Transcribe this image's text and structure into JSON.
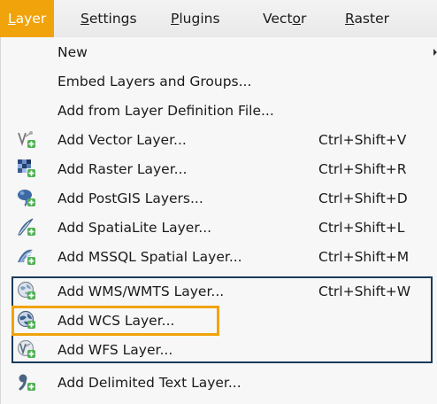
{
  "menubar": [
    {
      "pre": "",
      "u": "L",
      "post": "ayer",
      "active": true
    },
    {
      "pre": "",
      "u": "S",
      "post": "ettings",
      "active": false
    },
    {
      "pre": "",
      "u": "P",
      "post": "lugins",
      "active": false
    },
    {
      "pre": "Vect",
      "u": "o",
      "post": "r",
      "active": false
    },
    {
      "pre": "",
      "u": "R",
      "post": "aster",
      "active": false
    }
  ],
  "menu_items": [
    {
      "label": "New",
      "shortcut": "",
      "icon": "",
      "submenu": true
    },
    {
      "label": "Embed Layers and Groups...",
      "shortcut": "",
      "icon": ""
    },
    {
      "label": "Add from Layer Definition File...",
      "shortcut": "",
      "icon": ""
    },
    {
      "label": "Add Vector Layer...",
      "shortcut": "Ctrl+Shift+V",
      "icon": "vector-layer-icon"
    },
    {
      "label": "Add Raster Layer...",
      "shortcut": "Ctrl+Shift+R",
      "icon": "raster-layer-icon"
    },
    {
      "label": "Add PostGIS Layers...",
      "shortcut": "Ctrl+Shift+D",
      "icon": "postgis-icon"
    },
    {
      "label": "Add SpatiaLite Layer...",
      "shortcut": "Ctrl+Shift+L",
      "icon": "spatialite-icon"
    },
    {
      "label": "Add MSSQL Spatial Layer...",
      "shortcut": "Ctrl+Shift+M",
      "icon": "mssql-icon"
    },
    {
      "label": "Add WMS/WMTS Layer...",
      "shortcut": "Ctrl+Shift+W",
      "icon": "wms-icon"
    },
    {
      "label": "Add WCS Layer...",
      "shortcut": "",
      "icon": "wcs-icon"
    },
    {
      "label": "Add WFS Layer...",
      "shortcut": "",
      "icon": "wfs-icon"
    },
    {
      "label": "Add Delimited Text Layer...",
      "shortcut": "",
      "icon": "delimited-text-icon"
    }
  ],
  "colors": {
    "active_menu": "#f0a30a",
    "highlight_blue": "#1d3a5c",
    "highlight_orange": "#f0a30a"
  }
}
